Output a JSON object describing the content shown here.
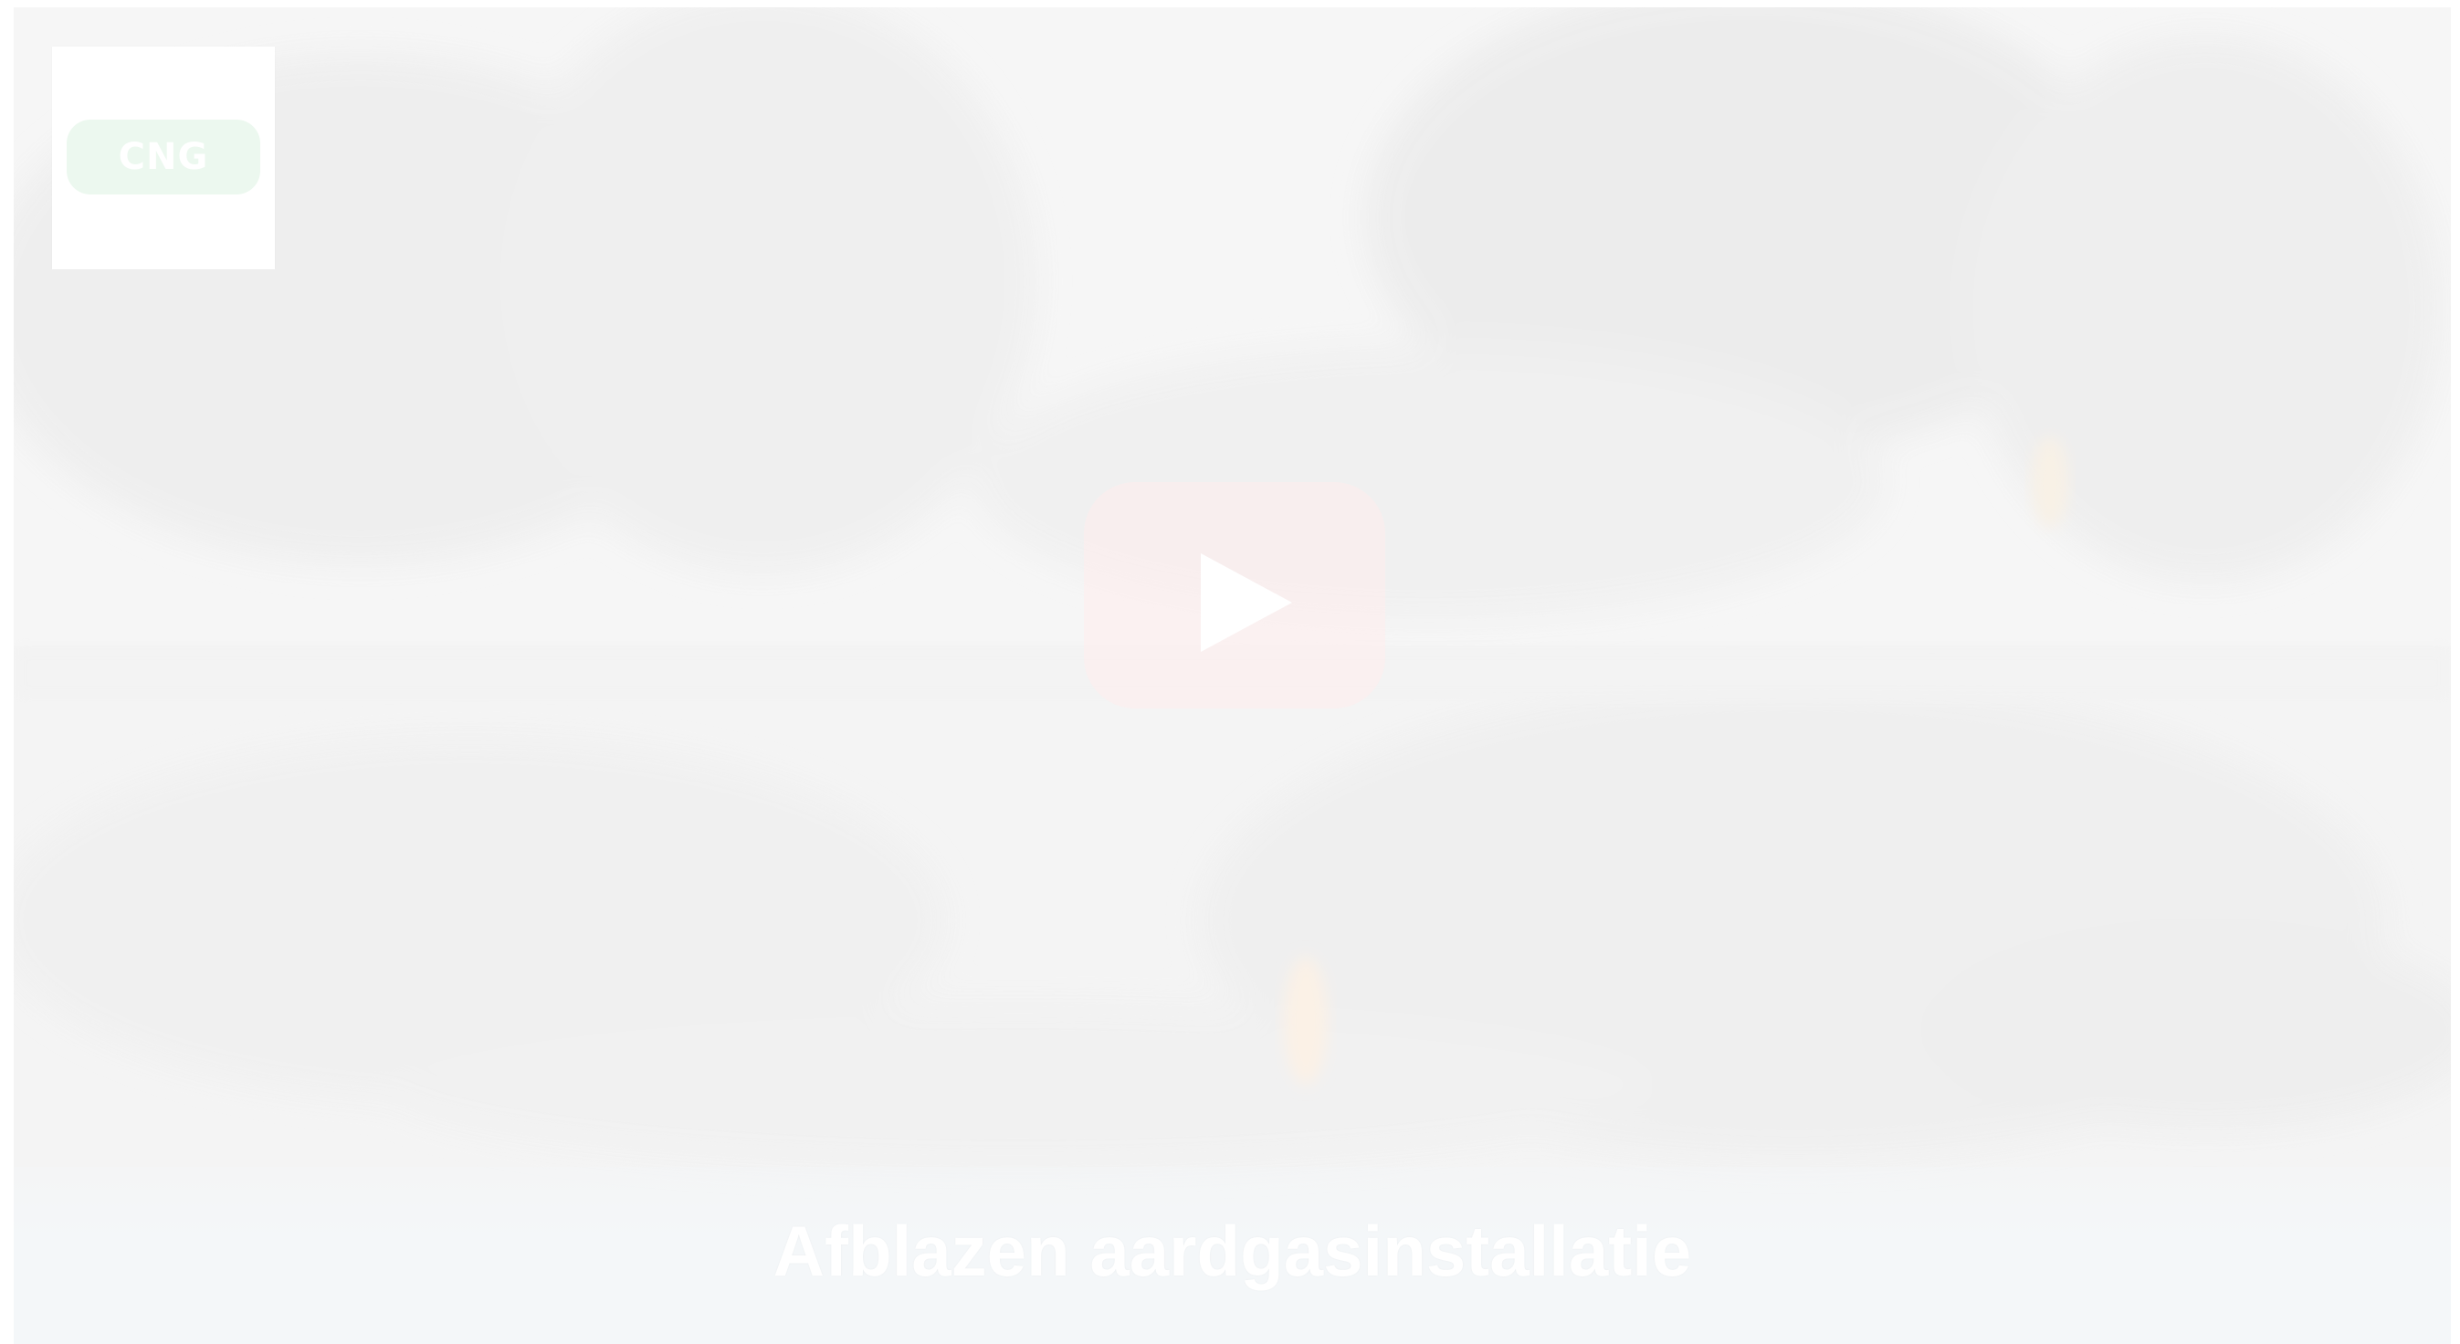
{
  "video": {
    "title": "Afblazen aardgasinstallatie"
  },
  "channel": {
    "logo_text": "CNG"
  },
  "play_button": {
    "icon": "play-icon",
    "color": "#ffecec"
  }
}
